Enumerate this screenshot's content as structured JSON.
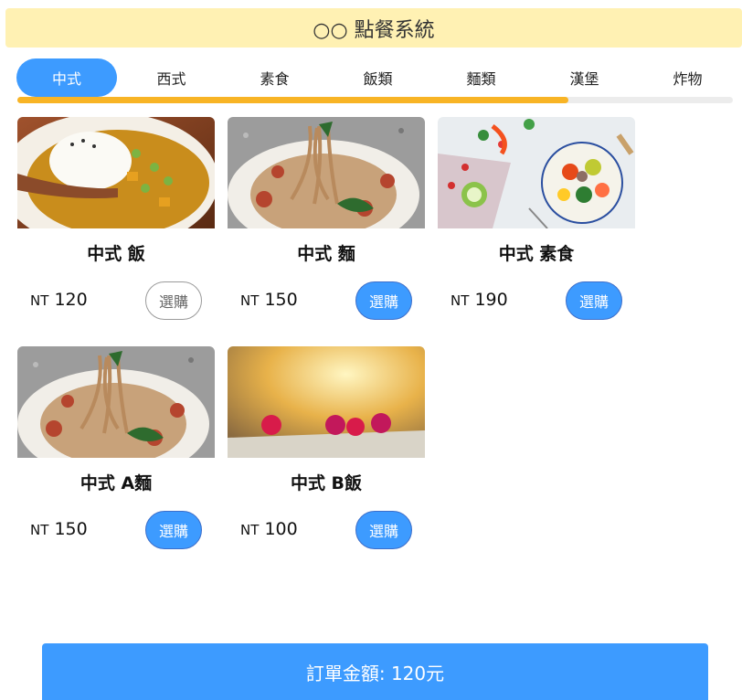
{
  "header": {
    "title": "○○ 點餐系統"
  },
  "tabs": [
    {
      "label": "中式",
      "active": true
    },
    {
      "label": "西式",
      "active": false
    },
    {
      "label": "素食",
      "active": false
    },
    {
      "label": "飯類",
      "active": false
    },
    {
      "label": "麵類",
      "active": false
    },
    {
      "label": "漢堡",
      "active": false
    },
    {
      "label": "炸物",
      "active": false
    }
  ],
  "tab_scroll_progress": 0.77,
  "items": [
    {
      "name": "中式 飯",
      "currency": "NT",
      "price": "120",
      "button": "選購",
      "selected": true,
      "image": "curry-rice"
    },
    {
      "name": "中式 麵",
      "currency": "NT",
      "price": "150",
      "button": "選購",
      "selected": false,
      "image": "spaghetti"
    },
    {
      "name": "中式 素食",
      "currency": "NT",
      "price": "190",
      "button": "選購",
      "selected": false,
      "image": "vegetable-salad"
    },
    {
      "name": "中式 A麵",
      "currency": "NT",
      "price": "150",
      "button": "選購",
      "selected": false,
      "image": "spaghetti"
    },
    {
      "name": "中式 B飯",
      "currency": "NT",
      "price": "100",
      "button": "選購",
      "selected": false,
      "image": "raspberries"
    }
  ],
  "order": {
    "label": "訂單金額: 120元"
  },
  "colors": {
    "accent": "#3d9bff",
    "header_bg": "#fff1b3",
    "progress": "#f8b425"
  }
}
